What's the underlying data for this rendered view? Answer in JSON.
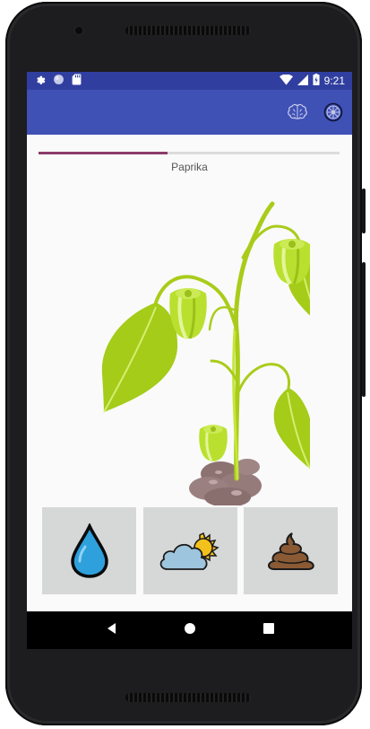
{
  "status_bar": {
    "time": "9:21",
    "left_icons": [
      "settings-icon",
      "circle-icon",
      "sd-card-icon"
    ],
    "right_icons": [
      "wifi-icon",
      "signal-icon",
      "battery-icon"
    ]
  },
  "app_bar": {
    "actions": [
      "brain-icon",
      "settings-wheel-icon"
    ],
    "color": "#3f51b5",
    "status_color": "#303f9f"
  },
  "plant": {
    "name": "Paprika",
    "growth_progress": 0.43,
    "progress_color": "#8e3b6a"
  },
  "care_actions": [
    {
      "name": "water",
      "icon": "water-drop-icon"
    },
    {
      "name": "sun",
      "icon": "sun-cloud-icon"
    },
    {
      "name": "fertilize",
      "icon": "poop-icon"
    }
  ],
  "navigation": [
    "back-icon",
    "home-icon",
    "recents-icon"
  ]
}
